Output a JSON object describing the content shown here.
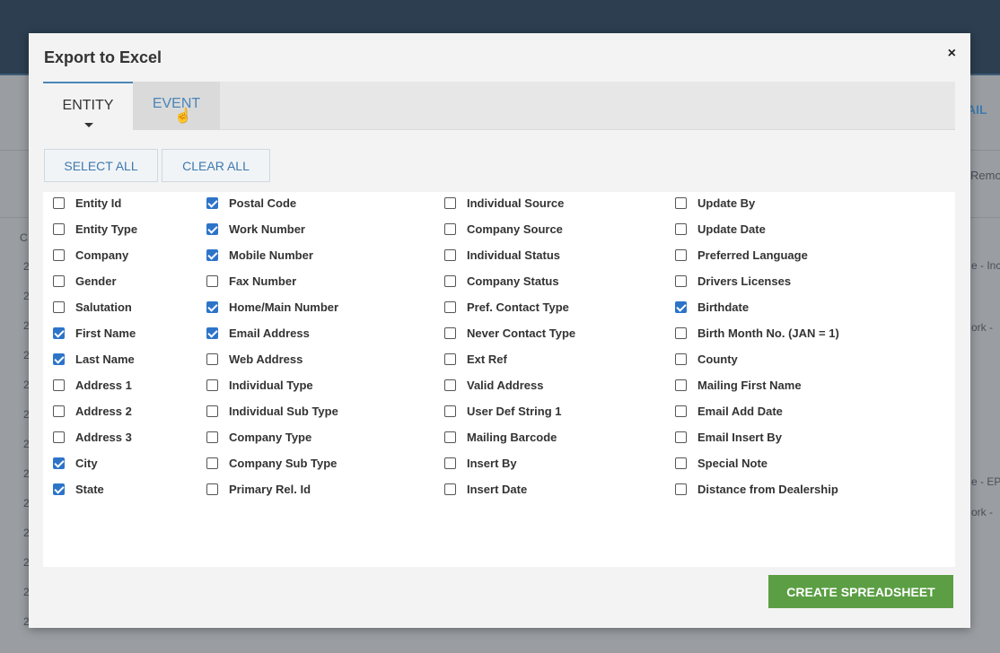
{
  "modal": {
    "title": "Export to Excel",
    "close_label": "×",
    "tabs": [
      {
        "label": "ENTITY",
        "active": true
      },
      {
        "label": "EVENT",
        "active": false
      }
    ],
    "select_all_label": "SELECT ALL",
    "clear_all_label": "CLEAR ALL",
    "create_label": "CREATE SPREADSHEET",
    "columns": [
      [
        {
          "label": "Entity Id",
          "checked": false
        },
        {
          "label": "Entity Type",
          "checked": false
        },
        {
          "label": "Company",
          "checked": false
        },
        {
          "label": "Gender",
          "checked": false
        },
        {
          "label": "Salutation",
          "checked": false
        },
        {
          "label": "First Name",
          "checked": true
        },
        {
          "label": "Last Name",
          "checked": true
        },
        {
          "label": "Address 1",
          "checked": false
        },
        {
          "label": "Address 2",
          "checked": false
        },
        {
          "label": "Address 3",
          "checked": false
        },
        {
          "label": "City",
          "checked": true
        },
        {
          "label": "State",
          "checked": true
        }
      ],
      [
        {
          "label": "Postal Code",
          "checked": true
        },
        {
          "label": "Work Number",
          "checked": true
        },
        {
          "label": "Mobile Number",
          "checked": true
        },
        {
          "label": "Fax Number",
          "checked": false
        },
        {
          "label": "Home/Main Number",
          "checked": true
        },
        {
          "label": "Email Address",
          "checked": true
        },
        {
          "label": "Web Address",
          "checked": false
        },
        {
          "label": "Individual Type",
          "checked": false
        },
        {
          "label": "Individual Sub Type",
          "checked": false
        },
        {
          "label": "Company Type",
          "checked": false
        },
        {
          "label": "Company Sub Type",
          "checked": false
        },
        {
          "label": "Primary Rel. Id",
          "checked": false
        }
      ],
      [
        {
          "label": "Individual Source",
          "checked": false
        },
        {
          "label": "Company Source",
          "checked": false
        },
        {
          "label": "Individual Status",
          "checked": false
        },
        {
          "label": "Company Status",
          "checked": false
        },
        {
          "label": "Pref. Contact Type",
          "checked": false
        },
        {
          "label": "Never Contact Type",
          "checked": false
        },
        {
          "label": "Ext Ref",
          "checked": false
        },
        {
          "label": "Valid Address",
          "checked": false
        },
        {
          "label": "User Def String 1",
          "checked": false
        },
        {
          "label": "Mailing Barcode",
          "checked": false
        },
        {
          "label": "Insert By",
          "checked": false
        },
        {
          "label": "Insert Date",
          "checked": false
        }
      ],
      [
        {
          "label": "Update By",
          "checked": false
        },
        {
          "label": "Update Date",
          "checked": false
        },
        {
          "label": "Preferred Language",
          "checked": false
        },
        {
          "label": "Drivers Licenses",
          "checked": false
        },
        {
          "label": "Birthdate",
          "checked": true
        },
        {
          "label": "Birth Month No. (JAN = 1)",
          "checked": false
        },
        {
          "label": "County",
          "checked": false
        },
        {
          "label": "Mailing First Name",
          "checked": false
        },
        {
          "label": "Email Add Date",
          "checked": false
        },
        {
          "label": "Email Insert By",
          "checked": false
        },
        {
          "label": "Special Note",
          "checked": false
        },
        {
          "label": "Distance from Dealership",
          "checked": false
        }
      ]
    ]
  },
  "background": {
    "right_link": "AIL",
    "right_header": "Remo",
    "right_snippets": [
      "e - Inc",
      "ork - ",
      "e - EP",
      "ork - "
    ],
    "left_column_header": "C",
    "left_cells": [
      "2",
      "2",
      "2",
      "2",
      "2",
      "2",
      "2",
      "2",
      "2",
      "2",
      "2",
      "2",
      "2"
    ]
  }
}
